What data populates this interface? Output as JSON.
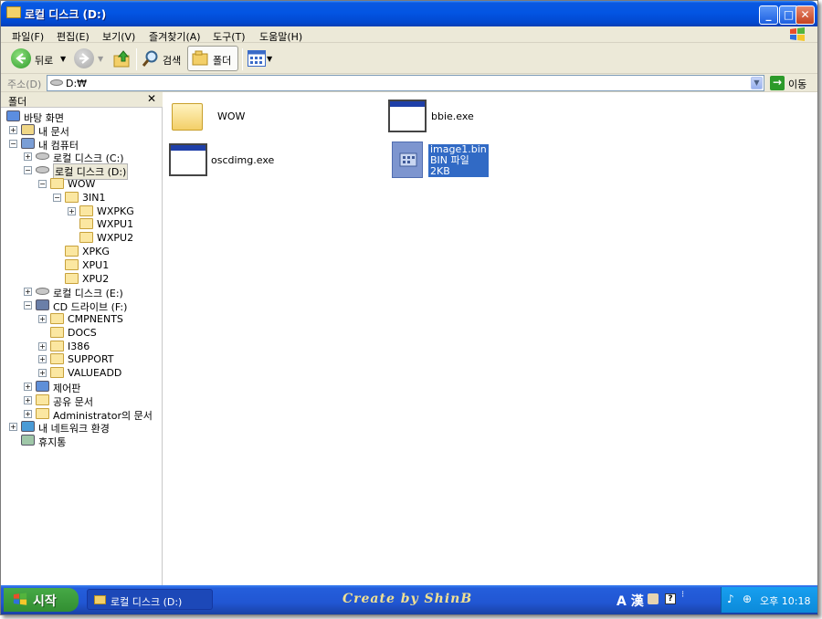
{
  "window": {
    "title": "로컬 디스크 (D:)",
    "controls": {
      "minimize": "_",
      "maximize": "□",
      "close": "✕"
    }
  },
  "menu": [
    "파일(F)",
    "편집(E)",
    "보기(V)",
    "즐겨찾기(A)",
    "도구(T)",
    "도움말(H)"
  ],
  "toolbar": {
    "back": "뒤로",
    "search": "검색",
    "folders": "폴더"
  },
  "address": {
    "label": "주소(D)",
    "value": "D:₩",
    "go": "이동"
  },
  "folder_pane": {
    "title": "폴더",
    "close": "✕",
    "tree": [
      {
        "label": "바탕 화면",
        "depth": 0,
        "exp": "",
        "icon": "desktop-icon"
      },
      {
        "label": "내 문서",
        "depth": 1,
        "exp": "+",
        "icon": "documents-icon"
      },
      {
        "label": "내 컴퓨터",
        "depth": 1,
        "exp": "−",
        "icon": "computer-icon"
      },
      {
        "label": "로컬 디스크 (C:)",
        "depth": 2,
        "exp": "+",
        "icon": "drive-icon"
      },
      {
        "label": "로컬 디스크 (D:)",
        "depth": 2,
        "exp": "−",
        "icon": "drive-icon",
        "selected": true
      },
      {
        "label": "WOW",
        "depth": 3,
        "exp": "−",
        "icon": "folder-icon"
      },
      {
        "label": "3IN1",
        "depth": 4,
        "exp": "−",
        "icon": "folder-icon"
      },
      {
        "label": "WXPKG",
        "depth": 5,
        "exp": "+",
        "icon": "folder-icon"
      },
      {
        "label": "WXPU1",
        "depth": 5,
        "exp": "",
        "icon": "folder-icon"
      },
      {
        "label": "WXPU2",
        "depth": 5,
        "exp": "",
        "icon": "folder-icon"
      },
      {
        "label": "XPKG",
        "depth": 4,
        "exp": "",
        "icon": "folder-icon"
      },
      {
        "label": "XPU1",
        "depth": 4,
        "exp": "",
        "icon": "folder-icon"
      },
      {
        "label": "XPU2",
        "depth": 4,
        "exp": "",
        "icon": "folder-icon"
      },
      {
        "label": "로컬 디스크 (E:)",
        "depth": 2,
        "exp": "+",
        "icon": "drive-icon"
      },
      {
        "label": "CD 드라이브 (F:)",
        "depth": 2,
        "exp": "−",
        "icon": "cd-drive-icon"
      },
      {
        "label": "CMPNENTS",
        "depth": 3,
        "exp": "+",
        "icon": "folder-icon"
      },
      {
        "label": "DOCS",
        "depth": 3,
        "exp": "",
        "icon": "folder-icon"
      },
      {
        "label": "I386",
        "depth": 3,
        "exp": "+",
        "icon": "folder-icon"
      },
      {
        "label": "SUPPORT",
        "depth": 3,
        "exp": "+",
        "icon": "folder-icon"
      },
      {
        "label": "VALUEADD",
        "depth": 3,
        "exp": "+",
        "icon": "folder-icon"
      },
      {
        "label": "제어판",
        "depth": 2,
        "exp": "+",
        "icon": "control-panel-icon"
      },
      {
        "label": "공유 문서",
        "depth": 2,
        "exp": "+",
        "icon": "folder-icon"
      },
      {
        "label": "Administrator의 문서",
        "depth": 2,
        "exp": "+",
        "icon": "folder-icon"
      },
      {
        "label": "내 네트워크 환경",
        "depth": 1,
        "exp": "+",
        "icon": "network-icon"
      },
      {
        "label": "휴지통",
        "depth": 1,
        "exp": "",
        "icon": "recycle-bin-icon"
      }
    ]
  },
  "content": {
    "items": [
      {
        "name": "WOW",
        "type": "folder"
      },
      {
        "name": "bbie.exe",
        "type": "exe"
      },
      {
        "name": "oscdimg.exe",
        "type": "exe"
      },
      {
        "name": "image1.bin",
        "type": "bin",
        "desc": "BIN 파일",
        "size": "2KB",
        "selected": true
      }
    ]
  },
  "taskbar": {
    "start": "시작",
    "task": "로컬 디스크 (D:)",
    "credit": "Create by ShinB",
    "lang": "A 漢",
    "time": "오후 10:18"
  }
}
